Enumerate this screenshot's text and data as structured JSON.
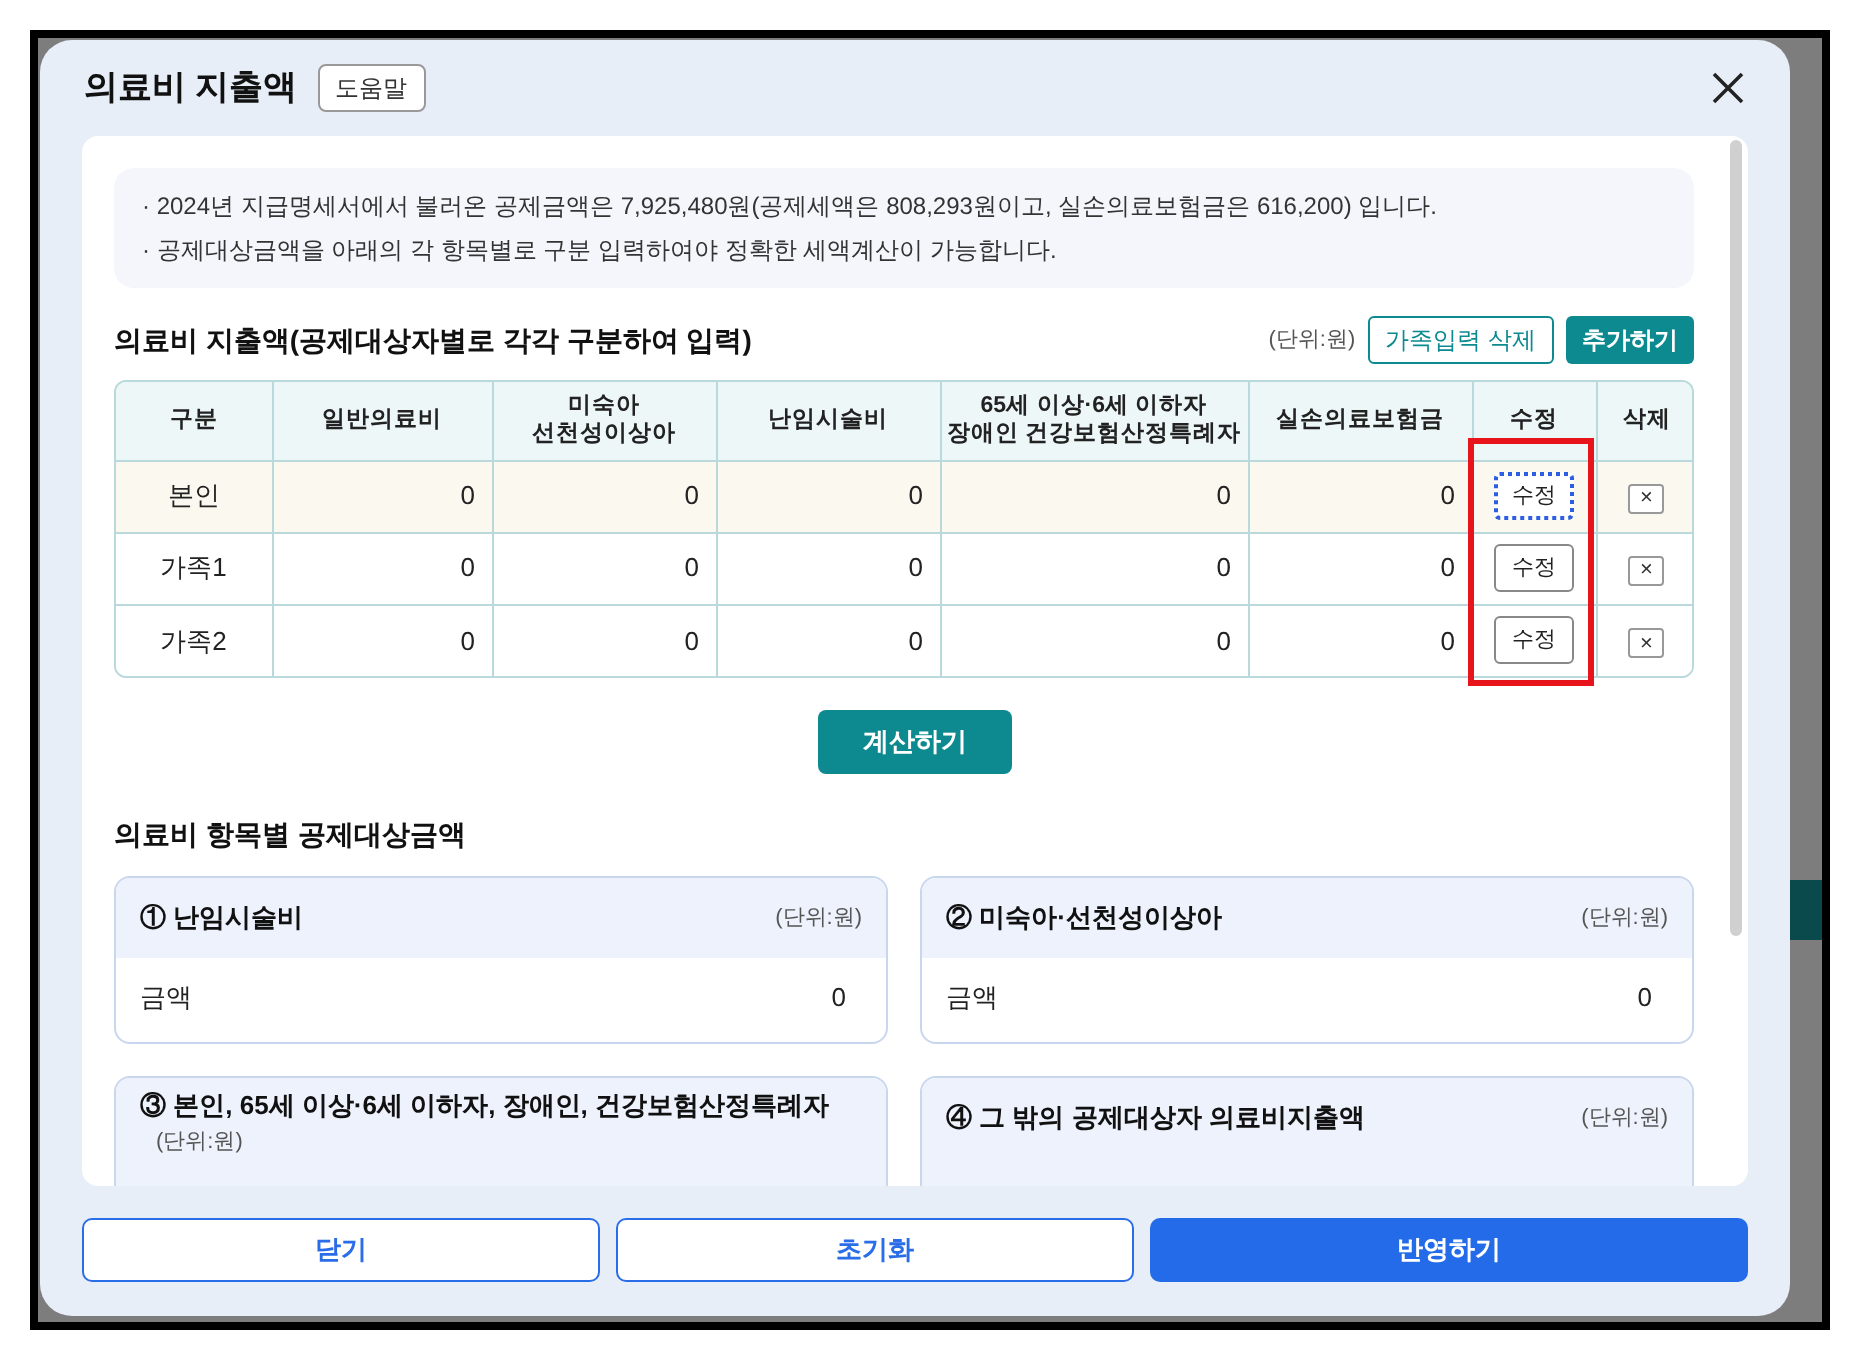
{
  "dialog": {
    "title": "의료비 지출액",
    "help_button": "도움말"
  },
  "notices": [
    "· 2024년 지급명세서에서 불러온 공제금액은 7,925,480원(공제세액은 808,293원이고, 실손의료보험금은 616,200) 입니다.",
    "· 공제대상금액을 아래의 각 항목별로 구분 입력하여야 정확한 세액계산이 가능합니다."
  ],
  "expense_section": {
    "title": "의료비 지출액(공제대상자별로 각각 구분하여 입력)",
    "unit": "(단위:원)",
    "buttons": [
      "가족입력 삭제",
      "추가하기"
    ]
  },
  "table": {
    "columns": [
      "구분",
      "일반의료비",
      "미숙아\n선천성이상아",
      "난임시술비",
      "65세 이상·6세 이하자\n장애인 건강보험산정특례자",
      "실손의료보험금",
      "수정",
      "삭제"
    ],
    "rows": [
      {
        "label": "본인",
        "values": [
          "0",
          "0",
          "0",
          "0",
          "0"
        ],
        "edit": "수정",
        "delete": "×",
        "selected": true,
        "edit_focused": true
      },
      {
        "label": "가족1",
        "values": [
          "0",
          "0",
          "0",
          "0",
          "0"
        ],
        "edit": "수정",
        "delete": "×",
        "selected": false,
        "edit_focused": false
      },
      {
        "label": "가족2",
        "values": [
          "0",
          "0",
          "0",
          "0",
          "0"
        ],
        "edit": "수정",
        "delete": "×",
        "selected": false,
        "edit_focused": false
      }
    ]
  },
  "calculate_button": "계산하기",
  "summary_section": {
    "title": "의료비 항목별 공제대상금액",
    "cards": [
      {
        "title": "① 난임시술비",
        "unit": "(단위:원)",
        "amount_label": "금액",
        "amount": "0"
      },
      {
        "title": "② 미숙아·선천성이상아",
        "unit": "(단위:원)",
        "amount_label": "금액",
        "amount": "0"
      },
      {
        "title": "③ 본인, 65세 이상·6세 이하자, 장애인, 건강보험산정특례자",
        "unit": "(단위:원)"
      },
      {
        "title": "④ 그 밖의 공제대상자 의료비지출액",
        "unit": "(단위:원)"
      }
    ]
  },
  "footer_buttons": [
    {
      "label": "닫기",
      "kind": "outline"
    },
    {
      "label": "초기화",
      "kind": "outline"
    },
    {
      "label": "반영하기",
      "kind": "primary"
    }
  ]
}
